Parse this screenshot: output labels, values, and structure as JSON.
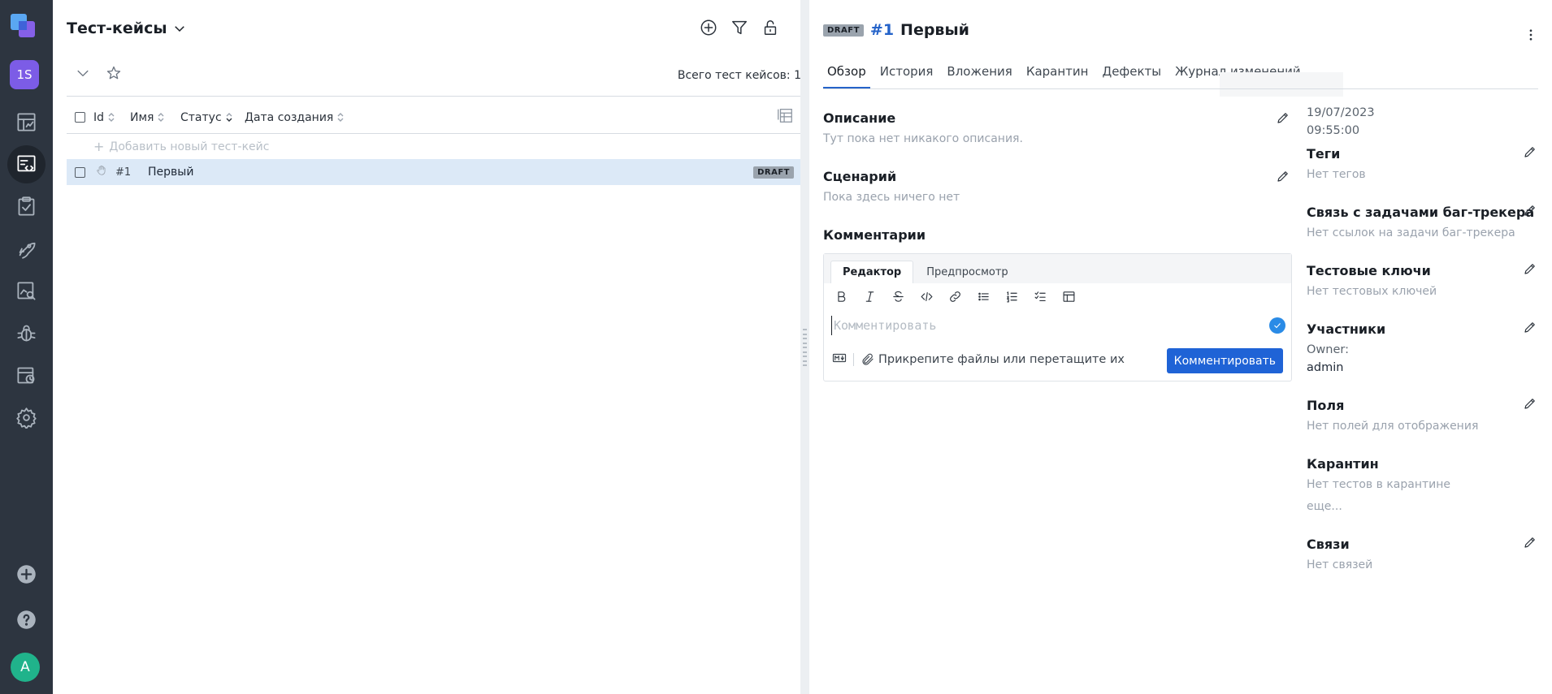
{
  "sidebar": {
    "project_badge": "1S",
    "avatar_letter": "A"
  },
  "left_panel": {
    "title": "Тест-кейсы",
    "total": "Всего тест кейсов: 1",
    "columns": {
      "id": "Id",
      "name": "Имя",
      "status": "Статус",
      "created": "Дата создания"
    },
    "add_new": "Добавить новый тест-кейс",
    "rows": [
      {
        "id": "#1",
        "name": "Первый",
        "status": "DRAFT"
      }
    ]
  },
  "detail": {
    "status_badge": "DRAFT",
    "id": "#1",
    "title": "Первый",
    "tabs": [
      "Обзор",
      "История",
      "Вложения",
      "Карантин",
      "Дефекты",
      "Журнал изменений"
    ],
    "description": {
      "title": "Описание",
      "empty": "Тут пока нет никакого описания."
    },
    "scenario": {
      "title": "Сценарий",
      "empty": "Пока здесь ничего нет"
    },
    "comments": {
      "title": "Комментарии",
      "tab_editor": "Редактор",
      "tab_preview": "Предпросмотр",
      "placeholder": "Комментировать",
      "attach": "Прикрепите файлы или перетащите их",
      "submit": "Комментировать"
    }
  },
  "meta": {
    "created_date": "19/07/2023",
    "created_time": "09:55:00",
    "tags": {
      "title": "Теги",
      "empty": "Нет тегов"
    },
    "issues": {
      "title": "Связь с задачами баг-трекера",
      "empty": "Нет ссылок на задачи баг-трекера"
    },
    "keys": {
      "title": "Тестовые ключи",
      "empty": "Нет тестовых ключей"
    },
    "members": {
      "title": "Участники",
      "owner_label": "Owner:",
      "owner_value": "admin"
    },
    "fields": {
      "title": "Поля",
      "empty": "Нет полей для отображения"
    },
    "quarantine": {
      "title": "Карантин",
      "empty": "Нет тестов в карантине",
      "more": "еще..."
    },
    "links": {
      "title": "Связи",
      "empty": "Нет связей"
    }
  }
}
